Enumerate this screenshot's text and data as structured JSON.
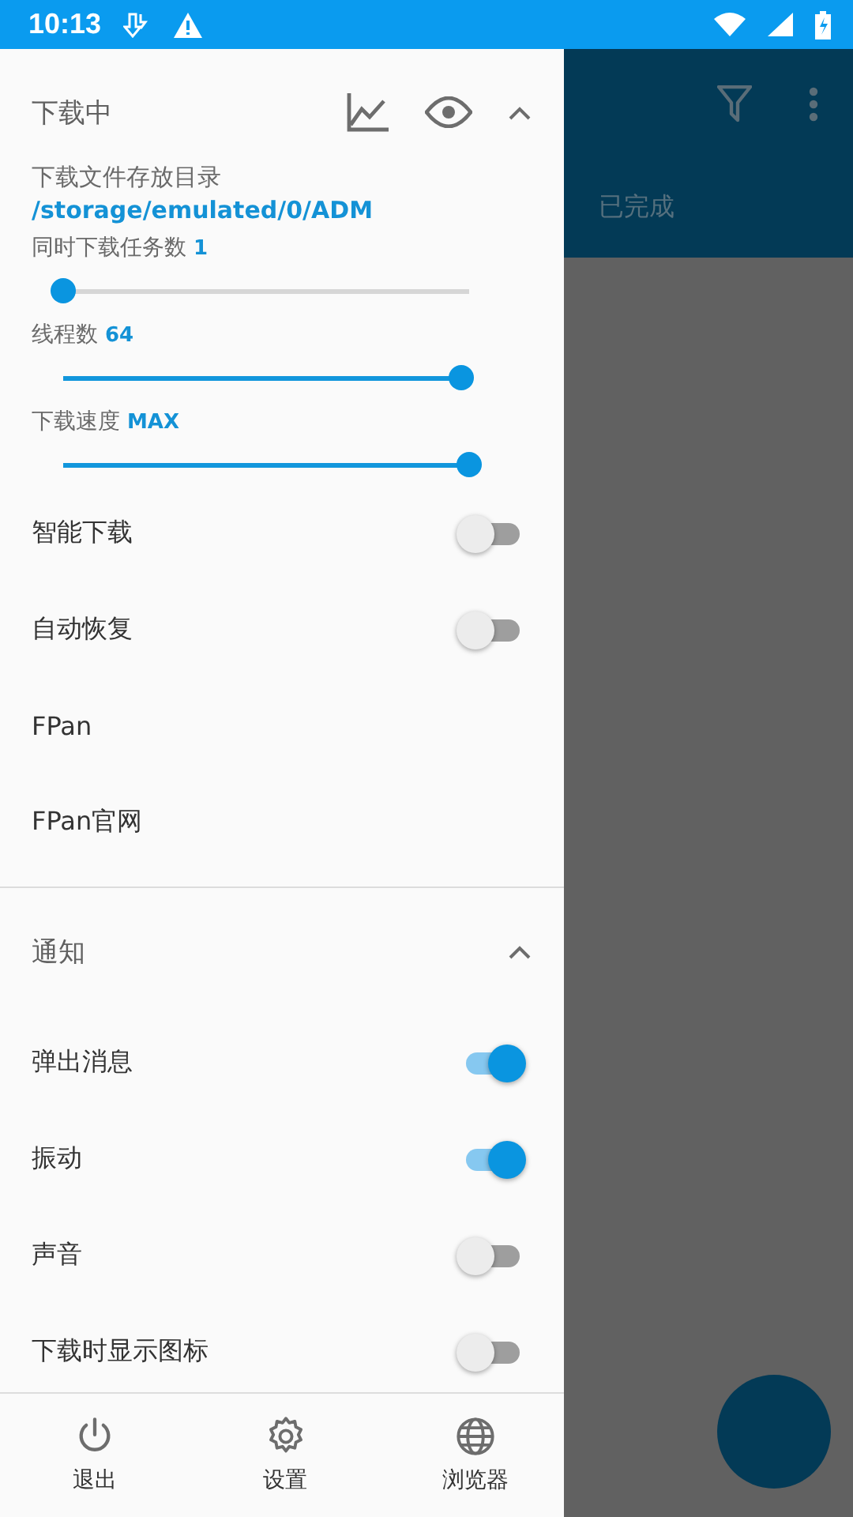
{
  "status_bar": {
    "time": "10:13"
  },
  "drawer": {
    "sections": [
      {
        "title": "下载中",
        "expanded": true,
        "items": [
          {
            "kind": "path",
            "label": "下载文件存放目录",
            "value": "/storage/emulated/0/ADM"
          },
          {
            "kind": "slider",
            "label": "同时下载任务数",
            "value": "1",
            "level": 0
          },
          {
            "kind": "slider",
            "label": "线程数",
            "value": "64",
            "level": 0.98
          },
          {
            "kind": "slider",
            "label": "下载速度",
            "value": "MAX",
            "level": 1
          },
          {
            "kind": "switch",
            "label": "智能下载",
            "on": false
          },
          {
            "kind": "switch",
            "label": "自动恢复",
            "on": false
          },
          {
            "kind": "link",
            "label": "FPan"
          },
          {
            "kind": "link",
            "label": "FPan官网"
          }
        ]
      },
      {
        "title": "通知",
        "expanded": true,
        "items": [
          {
            "kind": "switch",
            "label": "弹出消息",
            "on": true
          },
          {
            "kind": "switch",
            "label": "振动",
            "on": true
          },
          {
            "kind": "switch",
            "label": "声音",
            "on": false
          },
          {
            "kind": "switch",
            "label": "下载时显示图标",
            "on": false
          }
        ]
      }
    ],
    "bottom_nav": [
      {
        "label": "退出"
      },
      {
        "label": "设置"
      },
      {
        "label": "浏览器"
      }
    ]
  },
  "main": {
    "tab": "已完成"
  }
}
